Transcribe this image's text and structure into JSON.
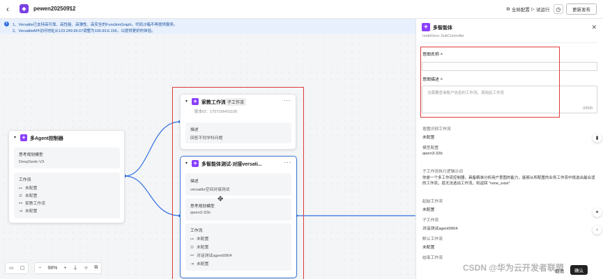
{
  "header": {
    "back_icon": "chevron-left-icon",
    "app_title": "pewen20250912",
    "global_config": "全局配置",
    "test_run": "试运行",
    "update_publish": "更新发布"
  },
  "notice": {
    "line1": "1、Versatile已支持高可靠、高性能、高弹性、高安全的FunctionGraph，代码沙箱不再提供服务。",
    "line2": "2、VersatileAPI访问地址从123.249.99.67调整为100.93.6.156，以提供更好的体验。"
  },
  "nodes": {
    "controller": {
      "title": "多Agent控制器",
      "model_label": "思考规划模型",
      "model_value": "DeepSeek-V3",
      "workflow_label": "工作流",
      "rows": [
        "未配置",
        "未配置",
        "家教工作流",
        "未配置"
      ]
    },
    "tutor": {
      "title": "家教工作流",
      "tag": "子工作流",
      "version_id": "版本ID：1757156431105",
      "desc_label": "描述",
      "desc_value": "回答不同学科问题"
    },
    "multi": {
      "title": "多智能体测试-对接versati...",
      "desc_label": "描述",
      "desc_value": "versatile空间对接测试",
      "model_label": "思考规划模型",
      "model_value": "qwen3-32b",
      "workflow_label": "工作流",
      "rows": [
        "未配置",
        "未配置",
        "对话测试agent0904",
        "未配置"
      ]
    }
  },
  "zoom": {
    "level": "98%"
  },
  "panel": {
    "title": "多智能体",
    "subtitle": "nodeDesc.SubController",
    "intent_name_label": "意图名称",
    "intent_desc_label": "意图描述",
    "intent_desc_placeholder": "当需要查询账户信息的工作流，调用此工作流",
    "intent_desc_count": "0/500",
    "default_workflow_label": "意图识别工作流",
    "default_workflow_value": "未配置",
    "model_label": "模型配置",
    "model_value": "qwen3-32b",
    "routing_label": "子工作流执行逻辑示词",
    "routing_value": "你是一个多工作流控制器，具备精准分析用户意图的能力，能够从所配置的业务工作流中挑选出最合适的工作流，若无法选出工作流，则返回 \"none_exist\"",
    "start_label": "起始工作流",
    "start_value": "未配置",
    "sub_label": "子工作流",
    "sub_value": "对话测试agent0904",
    "default_label": "默认工作流",
    "default_value": "未配置",
    "end_label": "结束工作流",
    "cancel": "取消",
    "confirm": "确认"
  },
  "watermark": "CSDN @华为云开发者联盟",
  "colors": {
    "accent": "#8a3ffc",
    "selected": "#3a7bd5",
    "highlight": "#e03a3a",
    "notice_bg": "#e7f0fc"
  }
}
